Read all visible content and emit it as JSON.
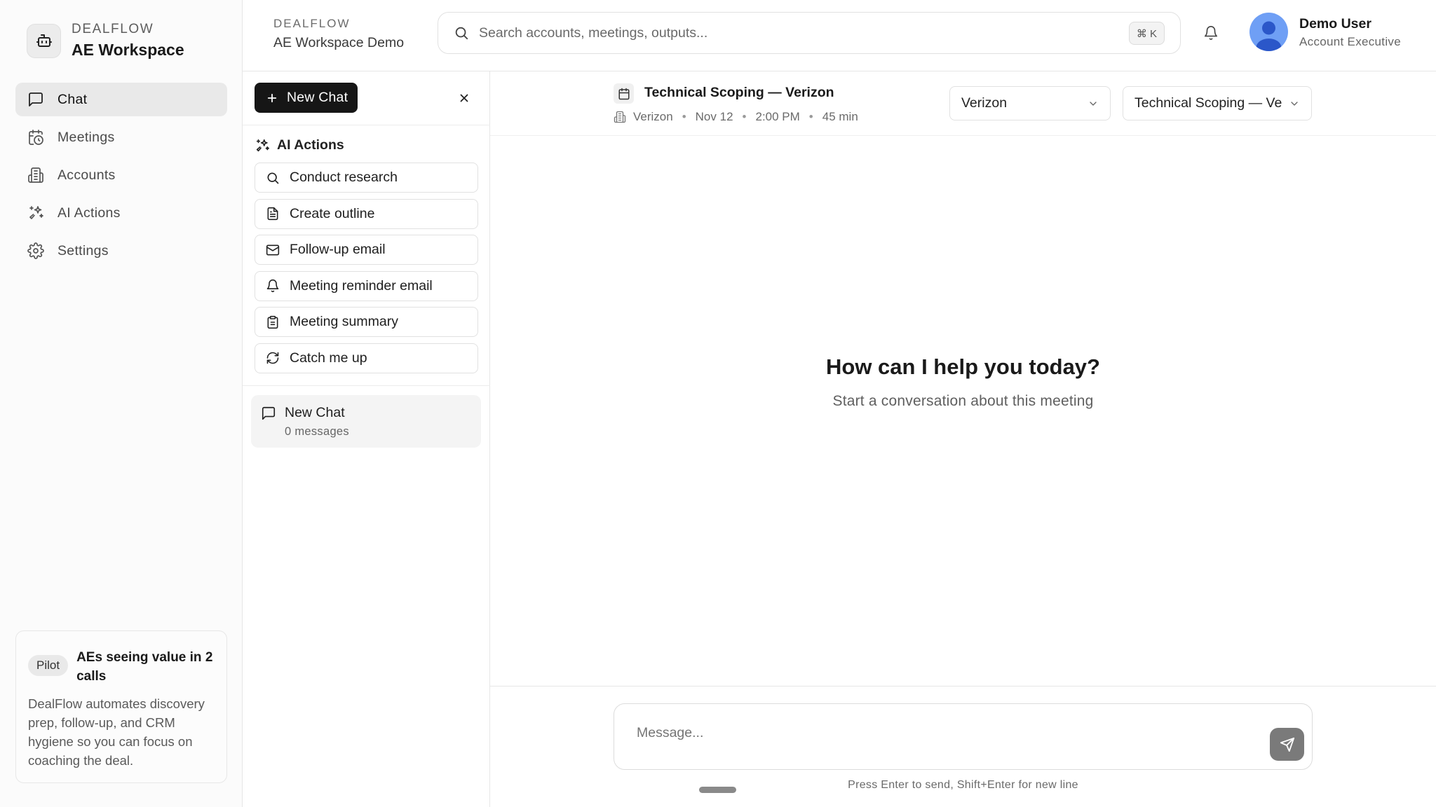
{
  "brand": {
    "kicker": "DEALFLOW",
    "title": "AE Workspace"
  },
  "nav": {
    "items": [
      {
        "label": "Chat",
        "icon": "message-square-icon",
        "active": true
      },
      {
        "label": "Meetings",
        "icon": "calendar-clock-icon",
        "active": false
      },
      {
        "label": "Accounts",
        "icon": "building-icon",
        "active": false
      },
      {
        "label": "AI Actions",
        "icon": "sparkles-icon",
        "active": false
      },
      {
        "label": "Settings",
        "icon": "gear-icon",
        "active": false
      }
    ]
  },
  "pilot": {
    "badge": "Pilot",
    "title": "AEs seeing value in 2 calls",
    "body": "DealFlow automates discovery prep, follow-up, and CRM hygiene so you can focus on coaching the deal."
  },
  "header": {
    "workspace_kicker": "DEALFLOW",
    "workspace_name": "AE Workspace Demo",
    "search_placeholder": "Search accounts, meetings, outputs...",
    "search_shortcut": "⌘ K",
    "user": {
      "name": "Demo User",
      "role": "Account Executive"
    }
  },
  "sidebar": {
    "new_chat_label": "New Chat",
    "ai_actions_heading": "AI Actions",
    "actions": [
      {
        "label": "Conduct research",
        "icon": "search-icon"
      },
      {
        "label": "Create outline",
        "icon": "file-text-icon"
      },
      {
        "label": "Follow-up email",
        "icon": "mail-icon"
      },
      {
        "label": "Meeting reminder email",
        "icon": "bell-icon"
      },
      {
        "label": "Meeting summary",
        "icon": "clipboard-icon"
      },
      {
        "label": "Catch me up",
        "icon": "refresh-icon"
      }
    ],
    "chats": [
      {
        "title": "New Chat",
        "subtitle": "0 messages"
      }
    ]
  },
  "meeting": {
    "title": "Technical Scoping — Verizon",
    "account": "Verizon",
    "date": "Nov 12",
    "time": "2:00 PM",
    "duration": "45 min",
    "account_select": "Verizon",
    "meeting_select": "Technical Scoping — Verizon"
  },
  "main": {
    "empty_title": "How can I help you today?",
    "empty_subtitle": "Start a conversation about this meeting",
    "composer_placeholder": "Message...",
    "hint": "Press Enter to send, Shift+Enter for new line"
  },
  "colors": {
    "primary_button": "#161616",
    "active_nav": "#e9e9e9",
    "avatar": "#6f9ff5",
    "send_button": "#7a7a7a"
  }
}
